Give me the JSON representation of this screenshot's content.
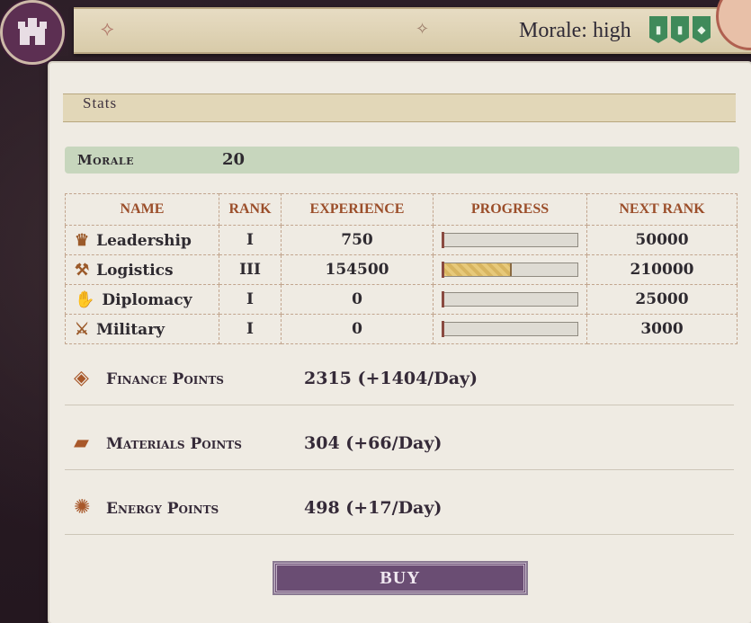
{
  "topbar": {
    "morale_text": "Morale: high",
    "banner_icons": [
      "tower-banner-icon",
      "tower-banner-icon",
      "shield-banner-icon"
    ]
  },
  "panel": {
    "title": "Stats",
    "morale": {
      "label": "Morale",
      "value": "20"
    },
    "table": {
      "headers": [
        "NAME",
        "RANK",
        "EXPERIENCE",
        "PROGRESS",
        "NEXT RANK"
      ],
      "rows": [
        {
          "name": "Leadership",
          "icon": "crown-icon",
          "rank": "I",
          "experience": "750",
          "progress": 0.0,
          "next_rank": "50000"
        },
        {
          "name": "Logistics",
          "icon": "tools-icon",
          "rank": "III",
          "experience": "154500",
          "progress": 0.5,
          "next_rank": "210000"
        },
        {
          "name": "Diplomacy",
          "icon": "handshake-icon",
          "rank": "I",
          "experience": "0",
          "progress": 0.0,
          "next_rank": "25000"
        },
        {
          "name": "Military",
          "icon": "crossed-swords-icon",
          "rank": "I",
          "experience": "0",
          "progress": 0.0,
          "next_rank": "3000"
        }
      ]
    },
    "points": [
      {
        "label": "Finance Points",
        "value": "2315 (+1404/Day)",
        "icon": "diamond-icon"
      },
      {
        "label": "Materials Points",
        "value": "304 (+66/Day)",
        "icon": "ingot-icon"
      },
      {
        "label": "Energy Points",
        "value": "498 (+17/Day)",
        "icon": "energy-swirl-icon"
      }
    ],
    "buy_label": "BUY"
  },
  "colors": {
    "panel_bg": "#efebe3",
    "header_text": "#9b4e2a",
    "morale_bar": "#c7d6bd",
    "buy_button": "#6a4d73",
    "banner_green": "#3f8a5a"
  }
}
